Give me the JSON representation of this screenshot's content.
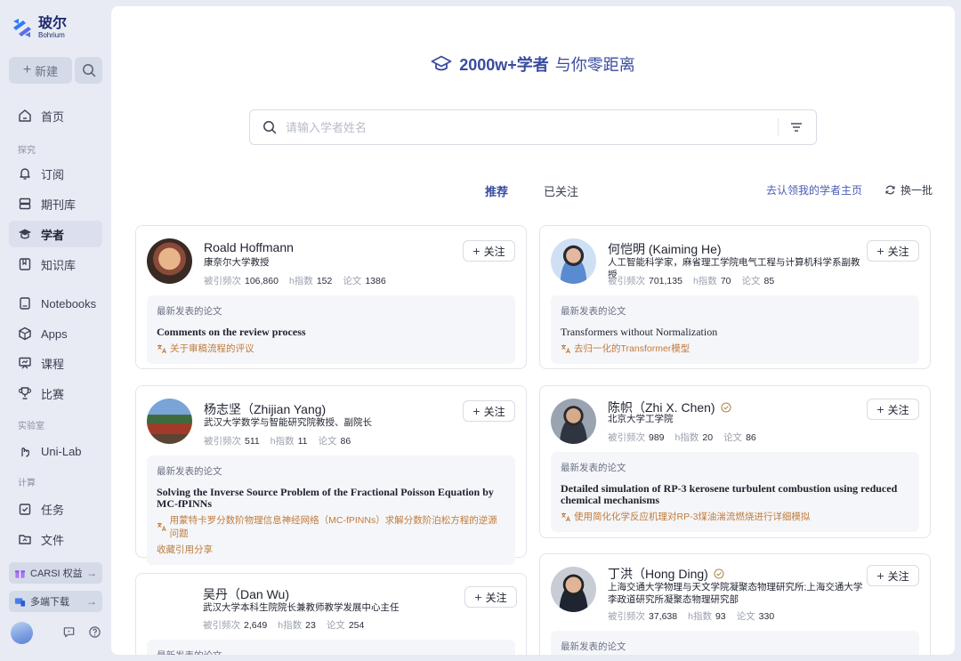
{
  "brand": {
    "name_cn": "玻尔",
    "name_en": "Bohrium"
  },
  "sidebar": {
    "new_label": "新建",
    "home": "首页",
    "section_explore": "探究",
    "subscribe": "订阅",
    "journals": "期刊库",
    "scholars": "学者",
    "knowledge": "知识库",
    "notebooks": "Notebooks",
    "apps": "Apps",
    "courses": "课程",
    "contests": "比赛",
    "section_lab": "实验室",
    "unilab": "Uni-Lab",
    "section_compute": "计算",
    "tasks": "任务",
    "files": "文件",
    "carsi": "CARSI 权益",
    "download": "多端下载"
  },
  "headline": {
    "count": "2000w+学者",
    "tagline": "与你零距离"
  },
  "search": {
    "placeholder": "请输入学者姓名"
  },
  "tabs": {
    "recommend": "推荐",
    "followed": "已关注"
  },
  "actions": {
    "claim": "去认领我的学者主页",
    "refresh": "换一批"
  },
  "labels": {
    "follow": "关注",
    "citations": "被引频次",
    "hindex": "h指数",
    "papers": "论文",
    "latest": "最新发表的论文"
  },
  "scholars": [
    {
      "name": "Roald Hoffmann",
      "affil": "康奈尔大学教授",
      "citations": "106,860",
      "h": "152",
      "papers": "1386",
      "paper_title": "Comments on the review process",
      "paper_tr": "关于审稿流程的评议"
    },
    {
      "name": "何恺明 (Kaiming He)",
      "affil": "人工智能科学家，麻省理工学院电气工程与计算机科学系副教授",
      "citations": "701,135",
      "h": "70",
      "papers": "85",
      "paper_title": "Transformers without Normalization",
      "paper_tr": "去归一化的Transformer模型"
    },
    {
      "name": "杨志坚（Zhijian Yang)",
      "affil": "武汉大学数学与智能研究院教授、副院长",
      "citations": "511",
      "h": "11",
      "papers": "86",
      "paper_title": "Solving the Inverse Source Problem of the Fractional Poisson Equation by MC-fPINNs",
      "paper_tr": "用蒙特卡罗分数阶物理信息神经网络（MC-fPINNs）求解分数阶泊松方程的逆源问题",
      "paper_extra": "收藏引用分享"
    },
    {
      "name": "陈帜（Zhi X. Chen)",
      "affil": "北京大学工学院",
      "citations": "989",
      "h": "20",
      "papers": "86",
      "paper_title": "Detailed simulation of RP-3 kerosene turbulent combustion using reduced chemical mechanisms",
      "paper_tr": "使用简化化学反应机理对RP-3煤油湍流燃烧进行详细模拟"
    },
    {
      "name": "吴丹（Dan Wu)",
      "affil": "武汉大学本科生院院长兼教师教学发展中心主任",
      "citations": "2,649",
      "h": "23",
      "papers": "254"
    },
    {
      "name": "丁洪（Hong Ding)",
      "affil": "上海交通大学物理与天文学院凝聚态物理研究所;上海交通大学李政道研究所凝聚态物理研究部",
      "citations": "37,638",
      "h": "93",
      "papers": "330"
    }
  ],
  "colors": {
    "accent": "#3a4ca0",
    "translation": "#c07b3c"
  }
}
